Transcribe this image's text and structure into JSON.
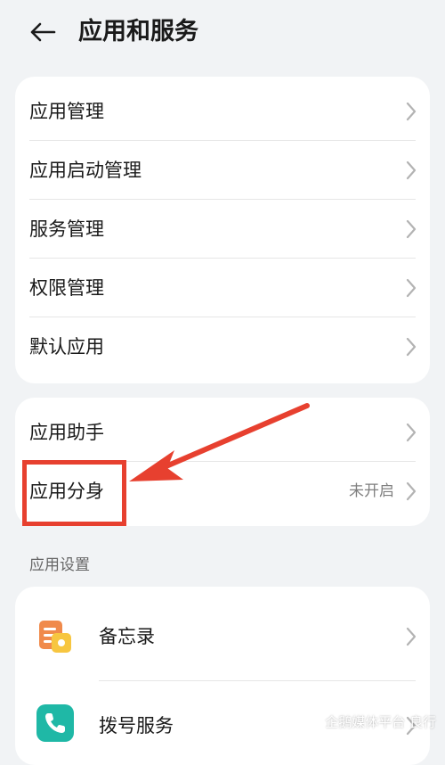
{
  "header": {
    "title": "应用和服务",
    "back_icon": "back-arrow-icon"
  },
  "group1": {
    "items": [
      {
        "label": "应用管理"
      },
      {
        "label": "应用启动管理"
      },
      {
        "label": "服务管理"
      },
      {
        "label": "权限管理"
      },
      {
        "label": "默认应用"
      }
    ]
  },
  "group2": {
    "items": [
      {
        "label": "应用助手",
        "value": ""
      },
      {
        "label": "应用分身",
        "value": "未开启"
      }
    ]
  },
  "app_settings": {
    "section_title": "应用设置",
    "items": [
      {
        "label": "备忘录",
        "icon": "notepad-icon"
      },
      {
        "label": "拨号服务",
        "icon": "phone-icon"
      }
    ]
  },
  "annotation": {
    "highlight_color": "#e7402f"
  },
  "watermark": {
    "text": "企鹅媒体平台 良行"
  },
  "colors": {
    "background": "#f1f3f5",
    "card": "#ffffff",
    "secondary_text": "#7f7f7f",
    "phone_icon": "#1fb8a6",
    "notepad_icon": "#f5a623"
  }
}
